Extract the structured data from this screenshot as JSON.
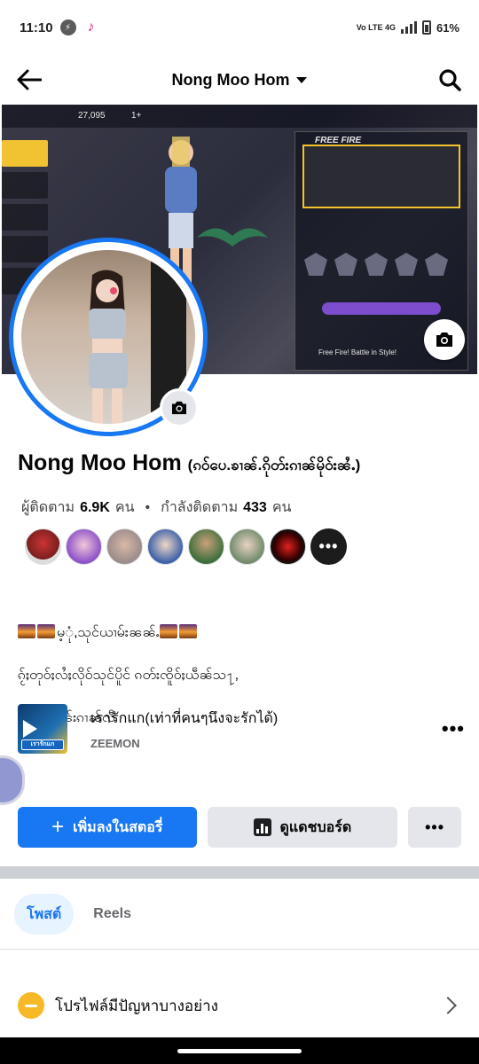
{
  "status_bar": {
    "time": "11:10",
    "network_labels": "Vo LTE  4G",
    "battery": "61%"
  },
  "header": {
    "title": "Nong Moo Hom"
  },
  "cover": {
    "game_brand": "FREE FIRE",
    "coins": "27,095",
    "diamonds": "1+",
    "tagline": "Free Fire! Battle in Style!"
  },
  "profile": {
    "name": "Nong Moo Hom",
    "alt_name": "(ၵဝ်ပေ.ၶၢၼ်.ၵိုတ်းၵၢၼ်မိုဝ်းၼႆႉ)",
    "followers_label": "ผู้ติดตาม",
    "followers_count": "6.9K",
    "followers_unit": "คน",
    "following_label": "กำลังติดตาม",
    "following_count": "433",
    "following_unit": "คน",
    "separator": "•",
    "friends_more": "•••"
  },
  "bio": {
    "line1": "မ့ုံ,သုင်ယၢမ်းၼၼ်ႉ",
    "line2": "ၵႂ်ႈတုဝ်ႈလႆႈလိုဝ်သုင်ပိူင် ၵတ်းၸိူဝ်ႈယဵၼ်သ႑,",
    "line3": "ၵႂ်ႈပ်ၼ်ဝၼ်းၵၢၼ်လီ"
  },
  "music": {
    "title": "เรารักแก(เท่าที่คนๆนึงจะรักได้)",
    "artist": "ZEEMON",
    "thumb_label": "เรารักแก"
  },
  "actions": {
    "add_story": "เพิ่มลงในสตอรี่",
    "dashboard": "ดูแดชบอร์ด",
    "more": "•••"
  },
  "tabs": [
    {
      "label": "โพสต์",
      "active": true
    },
    {
      "label": "Reels",
      "active": false
    }
  ],
  "notice": {
    "text": "โปรไฟล์มีปัญหาบางอย่าง"
  },
  "colors": {
    "accent": "#1877f2",
    "accent_light": "#e7f3ff",
    "secondary_button": "#e4e6eb",
    "warning": "#f7b928"
  },
  "icons": [
    "back-arrow-icon",
    "caret-down-icon",
    "search-icon",
    "camera-icon",
    "more-horizontal-icon",
    "plus-icon",
    "dashboard-icon",
    "minus-circle-icon",
    "chevron-right-icon",
    "play-icon"
  ]
}
